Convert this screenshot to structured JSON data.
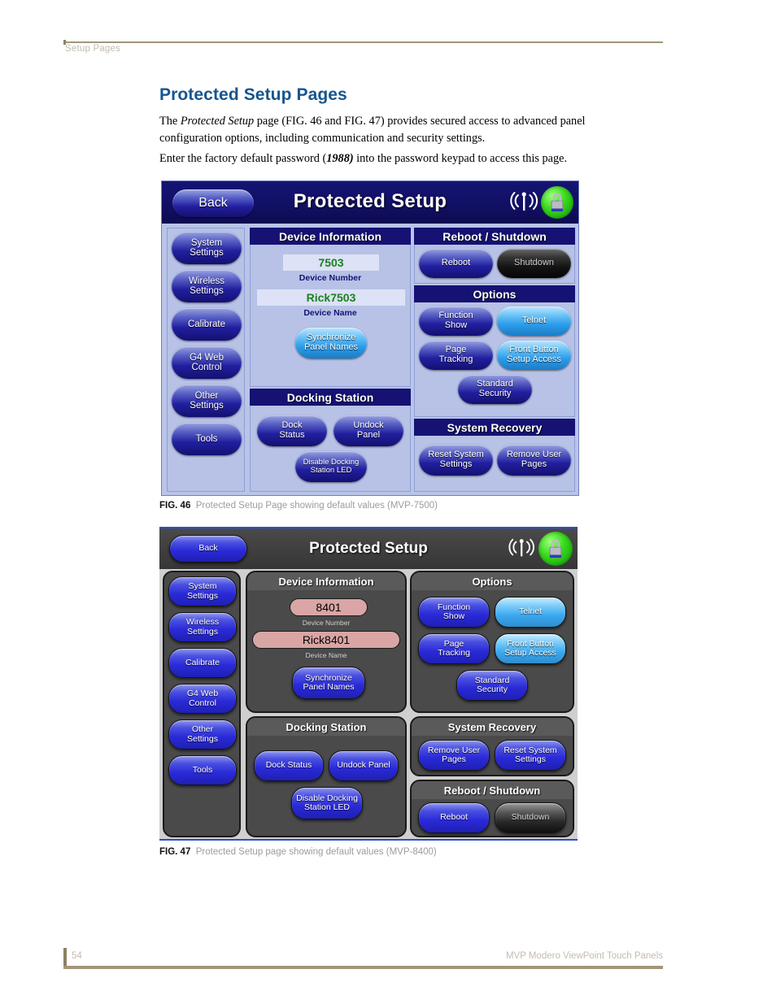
{
  "page": {
    "running_head": "Setup Pages",
    "folio": "54",
    "footer_right": "MVP Modero ViewPoint Touch Panels",
    "title": "Protected Setup Pages",
    "paragraph1_a": "The ",
    "paragraph1_i": "Protected Setup",
    "paragraph1_b": " page (FIG. 46 and FIG. 47) provides secured access to advanced panel configuration options, including communication and security settings.",
    "paragraph2_a": "Enter the factory default password (",
    "paragraph2_bold": "1988)",
    "paragraph2_b": " into the password keypad to access this page."
  },
  "colors": {
    "heading_blue": "#17558e",
    "rule_gold": "#a2967a",
    "fig46_panel_blue": "#b9c4e8",
    "fig46_titlebar": "#14136e",
    "fig46_value_green": "#18821f",
    "fig47_bg_grey": "#cfcfcf",
    "fig47_group_grey": "#4a4a4a",
    "fig47_value_pink": "#d9a5a5",
    "button_blue": "#2a2ad8",
    "button_cyan": "#3aa7ee",
    "lock_green": "#35d81a"
  },
  "fig46": {
    "caption_num": "FIG. 46",
    "caption_text": "Protected Setup Page showing default values (MVP-7500)",
    "titlebar": {
      "back_label": "Back",
      "title": "Protected Setup",
      "wifi_icon": "wireless-signal-icon",
      "lock_icon": "lock-icon"
    },
    "sidebar": [
      {
        "label": "System\nSettings"
      },
      {
        "label": "Wireless\nSettings"
      },
      {
        "label": "Calibrate"
      },
      {
        "label": "G4 Web\nControl"
      },
      {
        "label": "Other\nSettings"
      },
      {
        "label": "Tools"
      }
    ],
    "device_information": {
      "header": "Device Information",
      "device_number_value": "7503",
      "device_number_label": "Device Number",
      "device_name_value": "Rick7503",
      "device_name_label": "Device Name",
      "sync_button": "Synchronize\nPanel Names"
    },
    "docking_station": {
      "header": "Docking Station",
      "buttons": [
        {
          "label": "Dock\nStatus",
          "state": "normal"
        },
        {
          "label": "Undock\nPanel",
          "state": "normal"
        },
        {
          "label": "Disable Docking\nStation LED",
          "state": "normal"
        }
      ]
    },
    "reboot_shutdown": {
      "header": "Reboot / Shutdown",
      "buttons": [
        {
          "label": "Reboot",
          "state": "normal"
        },
        {
          "label": "Shutdown",
          "state": "dark"
        }
      ]
    },
    "options": {
      "header": "Options",
      "buttons": [
        {
          "label": "Function\nShow",
          "state": "normal"
        },
        {
          "label": "Telnet",
          "state": "cyan"
        },
        {
          "label": "Page\nTracking",
          "state": "normal"
        },
        {
          "label": "Front Button\nSetup Access",
          "state": "cyan"
        },
        {
          "label": "Standard\nSecurity",
          "state": "normal"
        }
      ]
    },
    "system_recovery": {
      "header": "System Recovery",
      "buttons": [
        {
          "label": "Reset System\nSettings",
          "state": "normal"
        },
        {
          "label": "Remove User\nPages",
          "state": "normal"
        }
      ]
    }
  },
  "fig47": {
    "caption_num": "FIG. 47",
    "caption_text": "Protected Setup page showing default values (MVP-8400)",
    "titlebar": {
      "back_label": "Back",
      "title": "Protected Setup",
      "wifi_icon": "wireless-signal-icon",
      "lock_icon": "lock-icon"
    },
    "sidebar": [
      {
        "label": "System\nSettings"
      },
      {
        "label": "Wireless\nSettings"
      },
      {
        "label": "Calibrate"
      },
      {
        "label": "G4 Web\nControl"
      },
      {
        "label": "Other\nSettings"
      },
      {
        "label": "Tools"
      }
    ],
    "device_information": {
      "header": "Device Information",
      "device_number_value": "8401",
      "device_number_label": "Device Number",
      "device_name_value": "Rick8401",
      "device_name_label": "Device Name",
      "sync_button": "Synchronize\nPanel Names"
    },
    "docking_station": {
      "header": "Docking Station",
      "buttons": [
        {
          "label": "Dock Status",
          "state": "normal"
        },
        {
          "label": "Undock Panel",
          "state": "normal"
        },
        {
          "label": "Disable Docking\nStation LED",
          "state": "normal"
        }
      ]
    },
    "options": {
      "header": "Options",
      "buttons": [
        {
          "label": "Function\nShow",
          "state": "normal"
        },
        {
          "label": "Telnet",
          "state": "cyan"
        },
        {
          "label": "Page\nTracking",
          "state": "normal"
        },
        {
          "label": "Front Button\nSetup Access",
          "state": "cyan"
        },
        {
          "label": "Standard\nSecurity",
          "state": "normal"
        }
      ]
    },
    "system_recovery": {
      "header": "System Recovery",
      "buttons": [
        {
          "label": "Remove User\nPages",
          "state": "normal"
        },
        {
          "label": "Reset System\nSettings",
          "state": "normal"
        }
      ]
    },
    "reboot_shutdown": {
      "header": "Reboot / Shutdown",
      "buttons": [
        {
          "label": "Reboot",
          "state": "normal"
        },
        {
          "label": "Shutdown",
          "state": "dark"
        }
      ]
    }
  }
}
